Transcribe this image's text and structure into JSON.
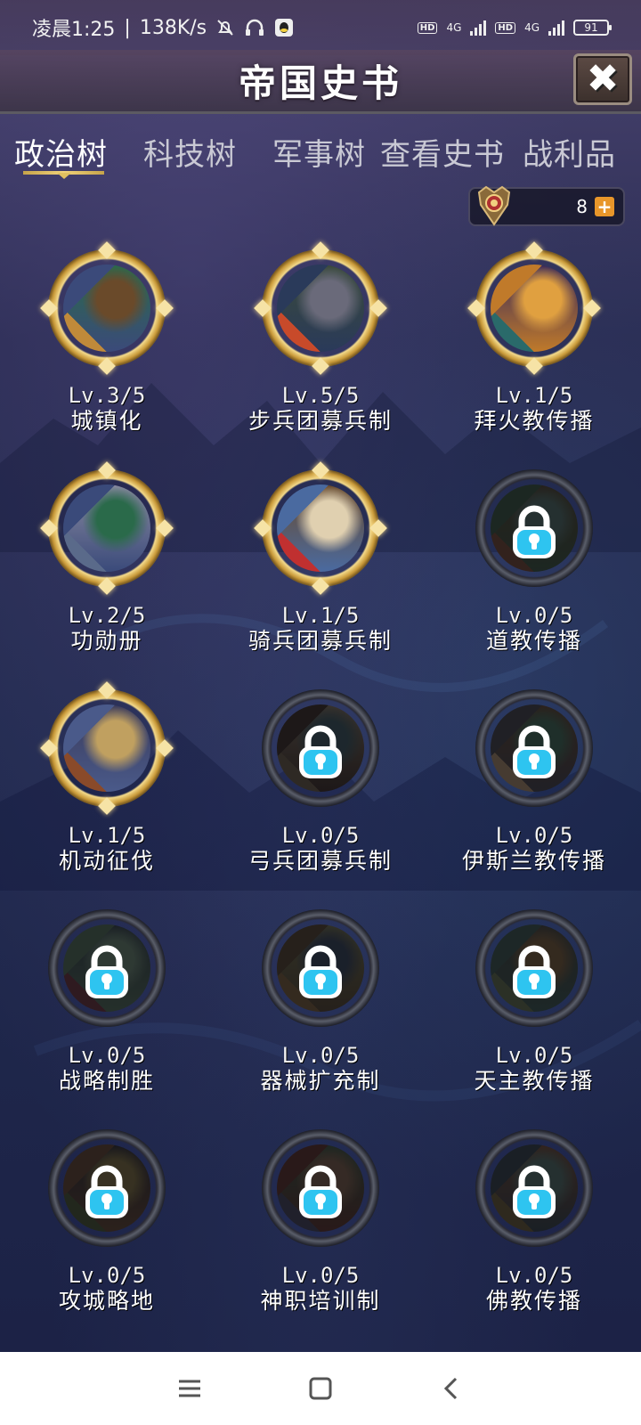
{
  "status_bar": {
    "time": "凌晨1:25",
    "speed": "138K/s",
    "network_1": "4G",
    "network_2": "4G",
    "hd_1": "HD",
    "hd_2": "HD",
    "battery": "91"
  },
  "header": {
    "title": "帝国史书",
    "close_icon": "close-icon"
  },
  "tabs": [
    {
      "label": "政治树",
      "active": true
    },
    {
      "label": "科技树",
      "active": false
    },
    {
      "label": "军事树",
      "active": false
    },
    {
      "label": "查看史书",
      "active": false
    },
    {
      "label": "战利品",
      "active": false
    }
  ],
  "currency": {
    "icon": "medal-icon",
    "count": "8",
    "add_icon": "plus-icon"
  },
  "nodes": [
    {
      "level": "Lv.3/5",
      "name": "城镇化",
      "locked": false
    },
    {
      "level": "Lv.5/5",
      "name": "步兵团募兵制",
      "locked": false
    },
    {
      "level": "Lv.1/5",
      "name": "拜火教传播",
      "locked": false
    },
    {
      "level": "Lv.2/5",
      "name": "功勋册",
      "locked": false
    },
    {
      "level": "Lv.1/5",
      "name": "骑兵团募兵制",
      "locked": false
    },
    {
      "level": "Lv.0/5",
      "name": "道教传播",
      "locked": true
    },
    {
      "level": "Lv.1/5",
      "name": "机动征伐",
      "locked": false
    },
    {
      "level": "Lv.0/5",
      "name": "弓兵团募兵制",
      "locked": true
    },
    {
      "level": "Lv.0/5",
      "name": "伊斯兰教传播",
      "locked": true
    },
    {
      "level": "Lv.0/5",
      "name": "战略制胜",
      "locked": true
    },
    {
      "level": "Lv.0/5",
      "name": "器械扩充制",
      "locked": true
    },
    {
      "level": "Lv.0/5",
      "name": "天主教传播",
      "locked": true
    },
    {
      "level": "Lv.0/5",
      "name": "攻城略地",
      "locked": true
    },
    {
      "level": "Lv.0/5",
      "name": "神职培训制",
      "locked": true
    },
    {
      "level": "Lv.0/5",
      "name": "佛教传播",
      "locked": true
    }
  ],
  "nav_bar": {
    "menu_icon": "menu-icon",
    "home_icon": "home-icon",
    "back_icon": "back-icon"
  },
  "colors": {
    "gold_ring": "#f3d98a",
    "lock_blue": "#2ec4f0",
    "plus_orange": "#e8962a"
  }
}
